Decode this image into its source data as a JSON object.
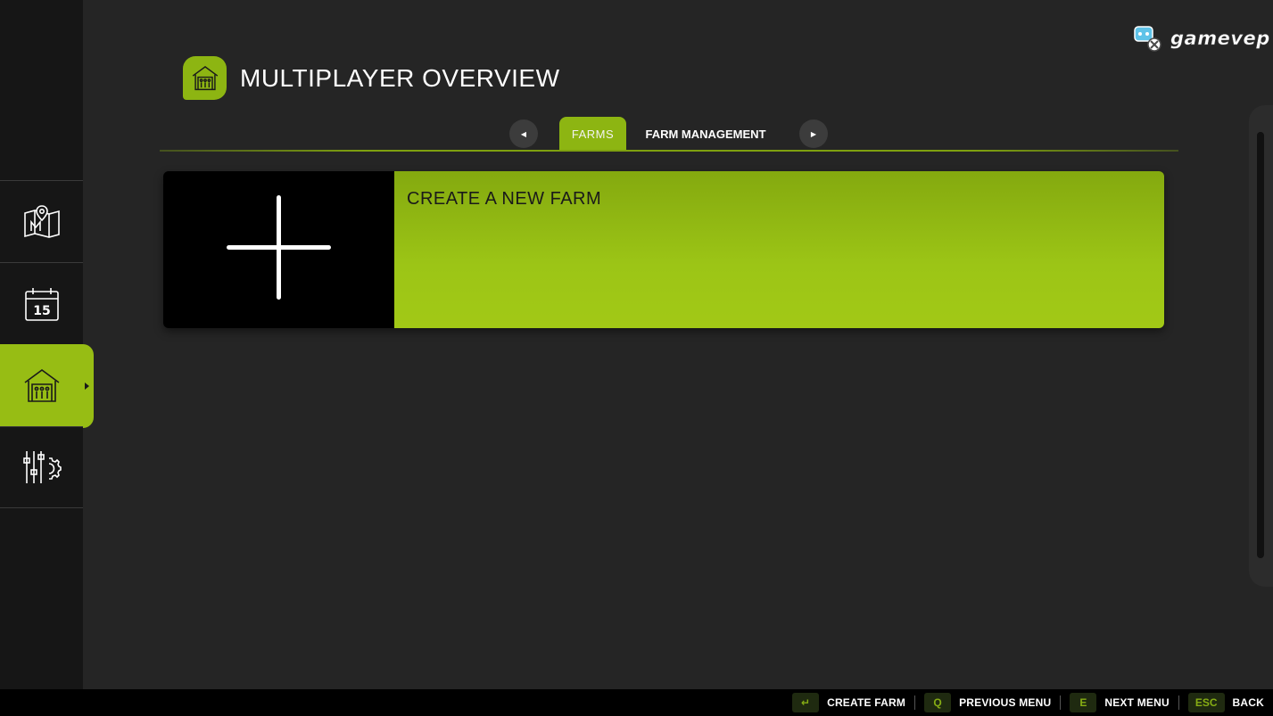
{
  "header": {
    "title": "MULTIPLAYER OVERVIEW",
    "icon": "farmhouse-icon"
  },
  "logo": {
    "text": "gamevep"
  },
  "sidebar": {
    "items": [
      {
        "icon": "map-icon",
        "active": false
      },
      {
        "icon": "calendar-icon",
        "badge": "15",
        "active": false
      },
      {
        "icon": "farmhouse-icon",
        "active": true
      },
      {
        "icon": "settings-sliders-icon",
        "active": false
      }
    ]
  },
  "tabs": {
    "items": [
      {
        "label": "FARMS",
        "active": true
      },
      {
        "label": "FARM MANAGEMENT",
        "active": false
      }
    ]
  },
  "farm_card": {
    "title": "CREATE A NEW FARM",
    "icon": "plus-icon"
  },
  "footer": {
    "hints": [
      {
        "key": "↵",
        "label": "CREATE FARM"
      },
      {
        "key": "Q",
        "label": "PREVIOUS MENU"
      },
      {
        "key": "E",
        "label": "NEXT MENU"
      },
      {
        "key": "ESC",
        "label": "BACK"
      }
    ]
  },
  "colors": {
    "accent": "#97bd14",
    "background": "#252525",
    "sidebar": "#161616"
  }
}
